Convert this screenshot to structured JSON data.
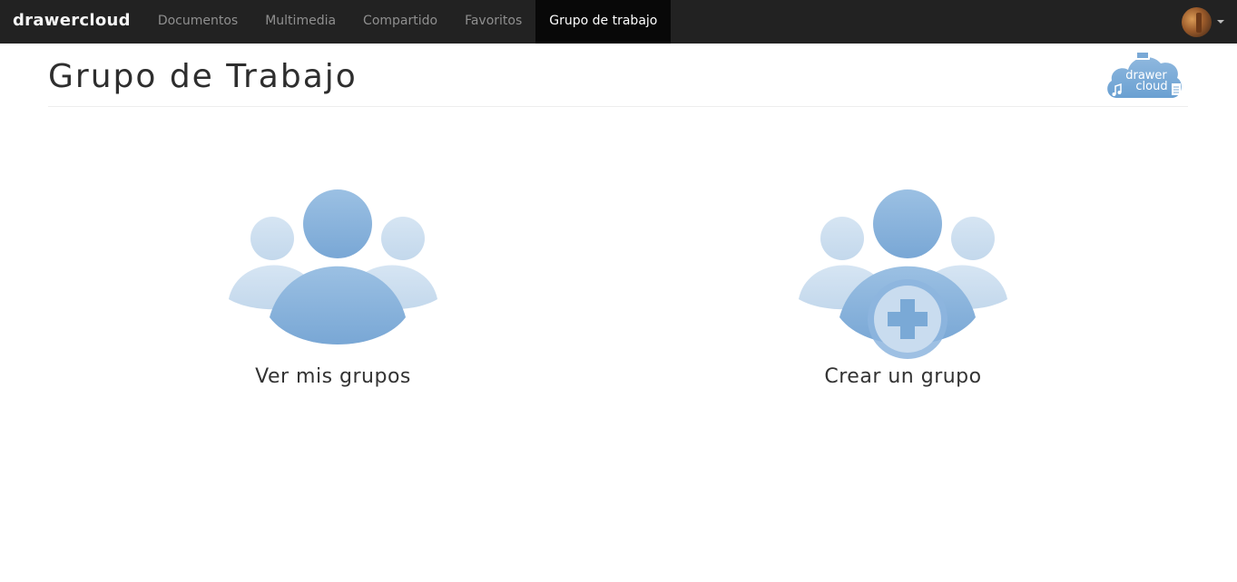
{
  "navbar": {
    "brand": "drawercloud",
    "items": [
      {
        "label": "Documentos",
        "active": false
      },
      {
        "label": "Multimedia",
        "active": false
      },
      {
        "label": "Compartido",
        "active": false
      },
      {
        "label": "Favoritos",
        "active": false
      },
      {
        "label": "Grupo de trabajo",
        "active": true
      }
    ]
  },
  "header": {
    "title": "Grupo de Trabajo",
    "logo_text_1": "drawer",
    "logo_text_2": "cloud"
  },
  "tiles": [
    {
      "label": "Ver mis grupos",
      "icon": "group-icon"
    },
    {
      "label": "Crear un grupo",
      "icon": "group-add-icon"
    }
  ],
  "colors": {
    "navbar_bg": "#222222",
    "active_bg": "#080808",
    "icon_dark": "#7aa9d6",
    "icon_light": "#c9dcef"
  }
}
